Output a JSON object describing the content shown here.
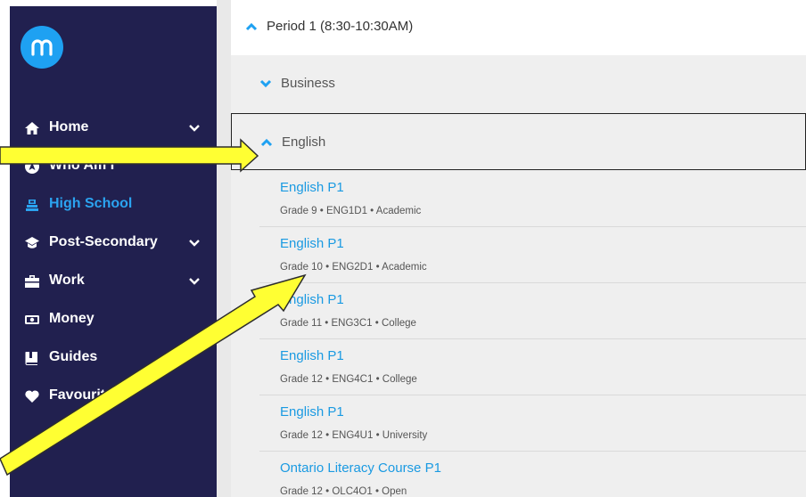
{
  "sidebar": {
    "items": [
      {
        "label": "Home",
        "icon": "home-icon",
        "has_chevron": true,
        "active": false
      },
      {
        "label": "Who Am I",
        "icon": "compass-icon",
        "has_chevron": false,
        "active": false
      },
      {
        "label": "High School",
        "icon": "school-icon",
        "has_chevron": false,
        "active": true
      },
      {
        "label": "Post-Secondary",
        "icon": "graduation-cap-icon",
        "has_chevron": true,
        "active": false
      },
      {
        "label": "Work",
        "icon": "briefcase-icon",
        "has_chevron": true,
        "active": false
      },
      {
        "label": "Money",
        "icon": "money-icon",
        "has_chevron": false,
        "active": false
      },
      {
        "label": "Guides",
        "icon": "book-icon",
        "has_chevron": false,
        "active": false
      },
      {
        "label": "Favourites",
        "icon": "heart-icon",
        "has_chevron": false,
        "active": false
      }
    ]
  },
  "period": {
    "label": "Period 1 (8:30-10:30AM)"
  },
  "subjects": [
    {
      "label": "Business",
      "expanded": false
    },
    {
      "label": "English",
      "expanded": true
    }
  ],
  "courses": [
    {
      "title": "English P1",
      "meta": "Grade 9 • ENG1D1 • Academic"
    },
    {
      "title": "English P1",
      "meta": "Grade 10 • ENG2D1 • Academic"
    },
    {
      "title": "English P1",
      "meta": "Grade 11 • ENG3C1 • College"
    },
    {
      "title": "English P1",
      "meta": "Grade 12 • ENG4C1 • College"
    },
    {
      "title": "English P1",
      "meta": "Grade 12 • ENG4U1 • University"
    },
    {
      "title": "Ontario Literacy Course P1",
      "meta": "Grade 12 • OLC4O1 • Open"
    }
  ],
  "colors": {
    "sidebar_bg": "#21204f",
    "accent_blue": "#1ea1f2",
    "annotation_arrow": "#ffff33"
  }
}
